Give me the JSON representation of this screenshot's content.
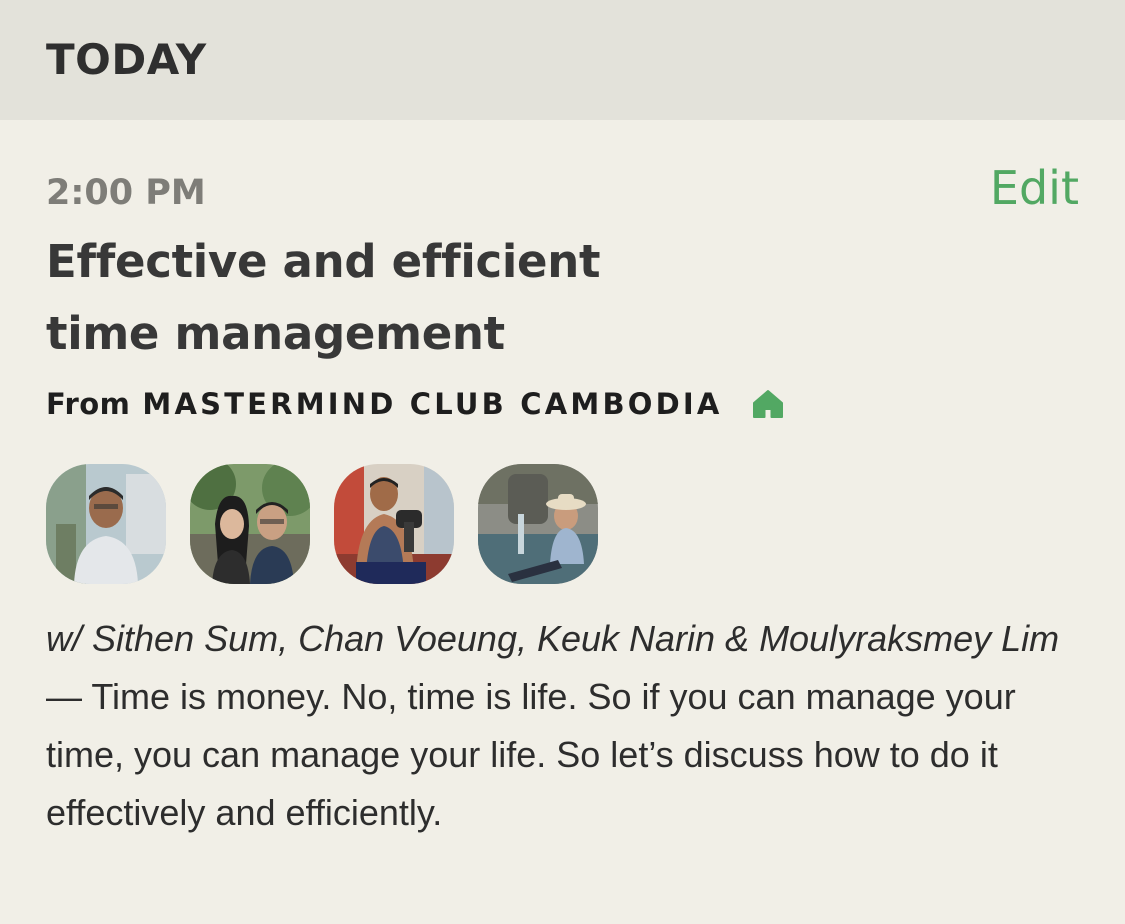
{
  "section": {
    "title": "TODAY"
  },
  "event": {
    "time": "2:00 PM",
    "edit_label": "Edit",
    "title": "Effective and efficient time management",
    "from_label": "From",
    "club_name": "MASTERMIND CLUB CAMBODIA",
    "club_icon": "house-icon",
    "speakers": [
      {
        "name": "Sithen Sum",
        "avatar": "avatar-photo"
      },
      {
        "name": "Chan Voeung",
        "avatar": "avatar-photo"
      },
      {
        "name": "Keuk Narin",
        "avatar": "avatar-photo"
      },
      {
        "name": "Moulyraksmey Lim",
        "avatar": "avatar-photo"
      }
    ],
    "with_prefix": "w/",
    "speaker_names_text": "Sithen Sum, Chan Voeung, Keuk Narin & Moulyraksmey Lim",
    "description": "— Time is money. No, time is life. So if you can manage your time, you can manage your life. So let’s discuss how to do it effectively and efficiently."
  },
  "colors": {
    "accent": "#52a863",
    "background": "#f1efe7",
    "header_background": "#e3e2da"
  }
}
